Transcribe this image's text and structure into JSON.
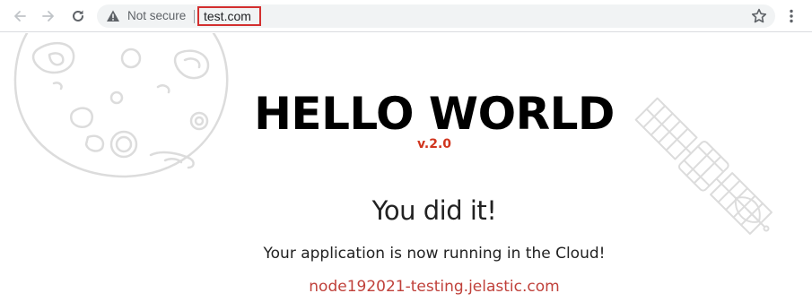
{
  "browser": {
    "security_label": "Not secure",
    "url": "test.com",
    "colors": {
      "url_highlight": "#d32f2f",
      "omnibox_bg": "#f1f3f4"
    }
  },
  "icons": {
    "back": "arrow-left-icon",
    "forward": "arrow-right-icon",
    "reload": "reload-icon",
    "security": "warning-triangle-icon",
    "bookmark": "star-icon",
    "menu": "kebab-menu-icon"
  },
  "page": {
    "title": "HELLO WORLD",
    "version": "v.2.0",
    "headline": "You did it!",
    "message": "Your application is now running in the Cloud!",
    "link_text": "node192021-testing.jelastic.com",
    "colors": {
      "version": "#d0351e",
      "link": "#c0413b",
      "illustration": "#dcdcdc"
    },
    "illustrations": [
      "planet-illustration",
      "satellite-illustration"
    ]
  }
}
